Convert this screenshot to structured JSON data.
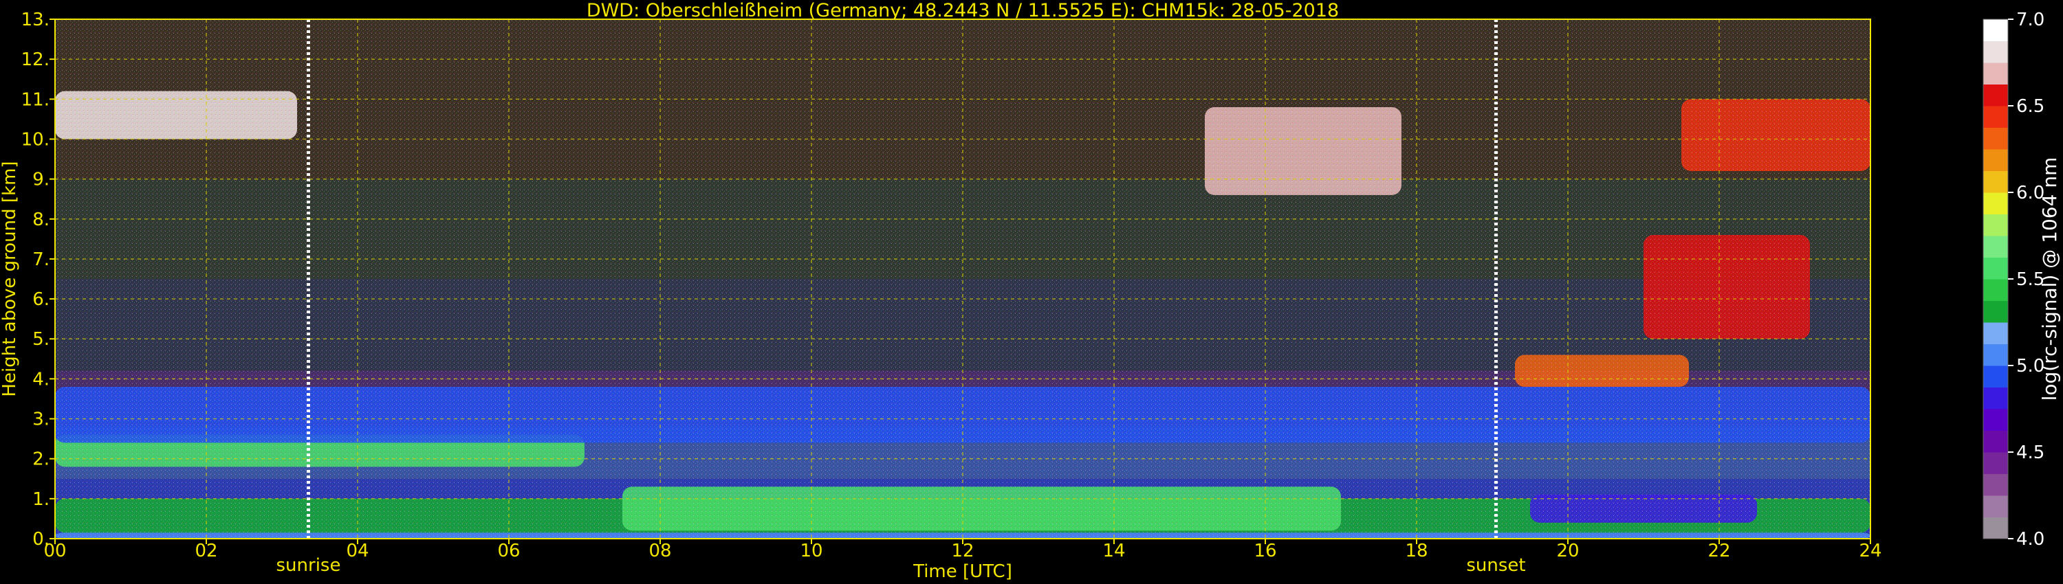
{
  "chart_data": {
    "type": "heatmap",
    "title": "DWD: Oberschleißheim (Germany; 48.2443 N / 11.5525 E):    CHM15k: 28-05-2018",
    "xlabel": "Time [UTC]",
    "ylabel": "Height above ground [km]",
    "xlim": [
      0,
      24
    ],
    "ylim": [
      0,
      13
    ],
    "x_ticks": [
      "00",
      "02",
      "04",
      "06",
      "08",
      "10",
      "12",
      "14",
      "16",
      "18",
      "20",
      "22",
      "24"
    ],
    "y_ticks": [
      "0.",
      "1.",
      "2.",
      "3.",
      "4.",
      "5.",
      "6.",
      "7.",
      "8.",
      "9.",
      "10.",
      "11.",
      "12.",
      "13."
    ],
    "grid": true,
    "events": [
      {
        "label": "sunrise",
        "time": 3.35
      },
      {
        "label": "sunset",
        "time": 19.05
      }
    ],
    "colorbar": {
      "label": "log(rc-signal) @ 1064 nm",
      "range": [
        4.0,
        7.0
      ],
      "ticks": [
        "4.0",
        "4.5",
        "5.0",
        "5.5",
        "6.0",
        "6.5",
        "7.0"
      ],
      "colors": [
        "#9a909c",
        "#a07aa6",
        "#8a4a98",
        "#76259a",
        "#6a0aa8",
        "#5a00c8",
        "#3a1ae0",
        "#2250f0",
        "#4a88f5",
        "#7aacf5",
        "#15a832",
        "#2cc845",
        "#48dc68",
        "#78ea82",
        "#a8f060",
        "#e8f028",
        "#f0c018",
        "#f09010",
        "#f06010",
        "#ee3010",
        "#e01010",
        "#e8b8b8",
        "#ede0e0",
        "#ffffff"
      ]
    },
    "layers": [
      {
        "name": "surface",
        "t0": 0,
        "t1": 24,
        "h0": 0,
        "h1": 0.15,
        "value": 5.0
      },
      {
        "name": "boundary-layer",
        "t0": 0,
        "t1": 24,
        "h0": 0.15,
        "h1": 1.0,
        "value": 5.3
      },
      {
        "name": "residual-layer",
        "t0": 0,
        "t1": 7,
        "h0": 1.8,
        "h1": 2.6,
        "value": 5.55
      },
      {
        "name": "mixed-layer",
        "t0": 7.5,
        "t1": 17,
        "h0": 0.2,
        "h1": 1.3,
        "value": 5.6
      },
      {
        "name": "elevated-aerosol",
        "t0": 0,
        "t1": 24,
        "h0": 2.4,
        "h1": 3.8,
        "value": 4.9
      },
      {
        "name": "evening-aerosol",
        "t0": 19.5,
        "t1": 22.5,
        "h0": 0.4,
        "h1": 1.1,
        "value": 4.8
      },
      {
        "name": "cirrus-morning",
        "t0": 0,
        "t1": 3.2,
        "h0": 10.0,
        "h1": 11.2,
        "value": 6.8
      },
      {
        "name": "cirrus-afternoon",
        "t0": 15.2,
        "t1": 17.8,
        "h0": 8.6,
        "h1": 10.8,
        "value": 6.7
      },
      {
        "name": "cirrus-late",
        "t0": 21.5,
        "t1": 24,
        "h0": 9.2,
        "h1": 11.0,
        "value": 6.4
      },
      {
        "name": "evening-cloud",
        "t0": 21.0,
        "t1": 23.2,
        "h0": 5.0,
        "h1": 7.6,
        "value": 6.5
      },
      {
        "name": "low-cloud",
        "t0": 19.3,
        "t1": 21.6,
        "h0": 3.8,
        "h1": 4.6,
        "value": 6.3
      }
    ]
  }
}
